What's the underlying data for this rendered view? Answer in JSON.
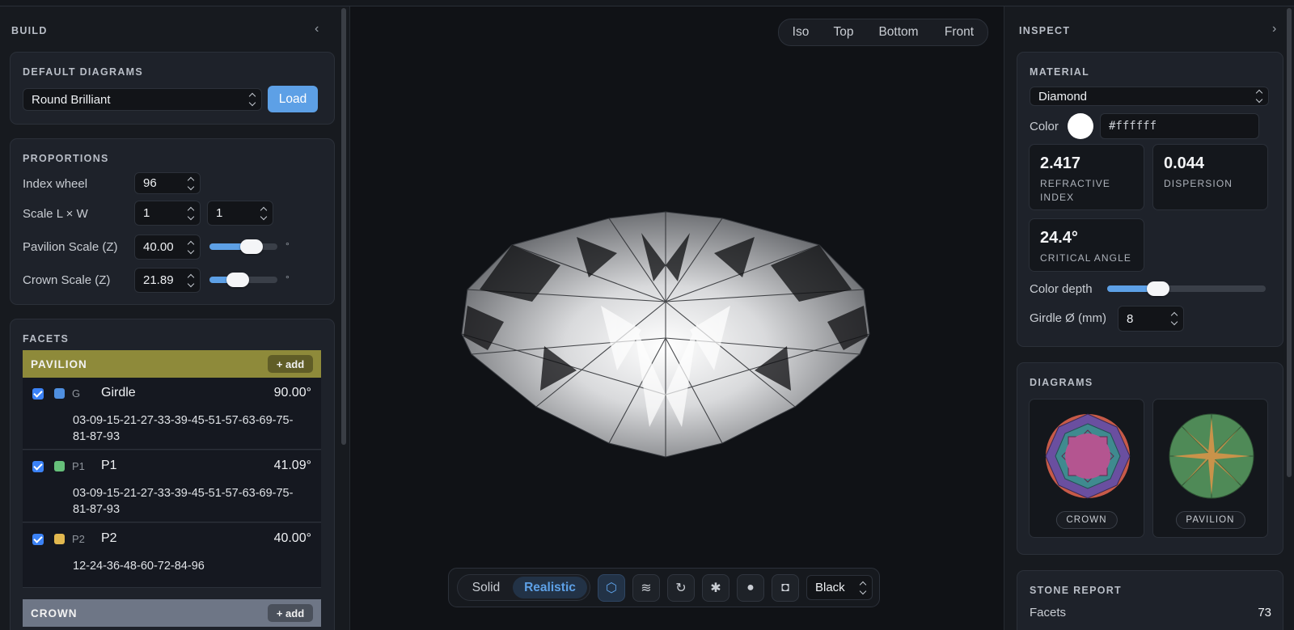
{
  "build": {
    "title": "BUILD",
    "default_diagrams": {
      "title": "DEFAULT DIAGRAMS",
      "selected": "Round Brilliant",
      "load_label": "Load"
    },
    "proportions": {
      "title": "PROPORTIONS",
      "index_wheel_label": "Index wheel",
      "index_wheel_value": "96",
      "scale_label": "Scale L × W",
      "scale_l": "1",
      "scale_w": "1",
      "pavilion_label": "Pavilion Scale (Z)",
      "pavilion_value": "40.00",
      "pavilion_level": 0.62,
      "crown_label": "Crown Scale (Z)",
      "crown_value": "21.89",
      "crown_level": 0.42,
      "deg_symbol": "°"
    },
    "facets": {
      "title": "FACETS",
      "pavilion": {
        "label": "PAVILION",
        "add_label": "+ add",
        "color": "#8e8a3a",
        "rows": [
          {
            "code": "G",
            "name": "Girdle",
            "angle": "90.00°",
            "indexes": "03-09-15-21-27-33-39-45-51-57-63-69-75-81-87-93",
            "color": "#4f8fe0"
          },
          {
            "code": "P1",
            "name": "P1",
            "angle": "41.09°",
            "indexes": "03-09-15-21-27-33-39-45-51-57-63-69-75-81-87-93",
            "color": "#66c07a"
          },
          {
            "code": "P2",
            "name": "P2",
            "angle": "40.00°",
            "indexes": "12-24-36-48-60-72-84-96",
            "color": "#e2b84f"
          }
        ]
      },
      "crown": {
        "label": "CROWN",
        "add_label": "+ add",
        "color": "#6e7686"
      }
    }
  },
  "viewport": {
    "views": [
      "Iso",
      "Top",
      "Bottom",
      "Front"
    ],
    "render_modes": [
      "Solid",
      "Realistic"
    ],
    "active_mode": "Realistic",
    "tool_icons": [
      "cube-icon",
      "layers-icon",
      "rotate-icon",
      "snowflake-icon",
      "dot-icon",
      "camera-icon"
    ],
    "background": "Black"
  },
  "inspect": {
    "title": "INSPECT",
    "material": {
      "title": "MATERIAL",
      "selected": "Diamond",
      "color_label": "Color",
      "color_hex": "#ffffff",
      "refractive_index": "2.417",
      "refractive_label": "REFRACTIVE INDEX",
      "dispersion": "0.044",
      "dispersion_label": "DISPERSION",
      "critical_angle": "24.4°",
      "critical_label": "CRITICAL ANGLE",
      "color_depth_label": "Color depth",
      "color_depth_level": 0.32,
      "girdle_label": "Girdle Ø (mm)",
      "girdle_value": "8"
    },
    "diagrams": {
      "title": "DIAGRAMS",
      "crown_label": "CROWN",
      "pavilion_label": "PAVILION"
    },
    "stone_report": {
      "title": "STONE REPORT",
      "facets_label": "Facets",
      "facets_value": "73"
    }
  }
}
